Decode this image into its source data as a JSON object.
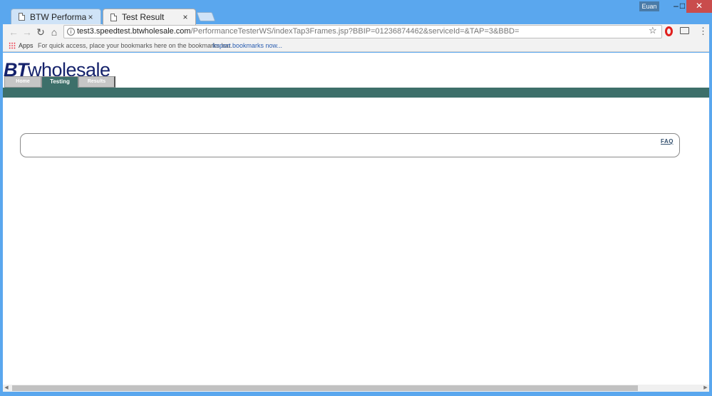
{
  "browser": {
    "tabs": [
      {
        "title": "BTW Performance Test",
        "close": "×"
      },
      {
        "title": "Test Result",
        "close": "×"
      }
    ],
    "profile_name": "Euan",
    "window_buttons": {
      "minimize": "–",
      "maximize": "□",
      "close": "✕"
    },
    "nav": {
      "back": "←",
      "forward": "→",
      "reload": "↻",
      "home": "⌂"
    },
    "url": {
      "host": "test3.speedtest.btwholesale.com",
      "path": "/PerformanceTesterWS/indexTap3Frames.jsp?BBIP=01236874462&serviceId=&TAP=3&BBD="
    },
    "star": "☆",
    "menu": "⋮",
    "bookmarks": {
      "apps_label": "Apps",
      "hint": "For quick access, place your bookmarks here on the bookmarks bar.",
      "import_link": "Import bookmarks now..."
    }
  },
  "page": {
    "logo": {
      "bt": "BT",
      "wholesale": "wholesale"
    },
    "nav_tabs": [
      {
        "label": "Home"
      },
      {
        "label": "Testing"
      },
      {
        "label": "Results"
      }
    ],
    "faq_link": "FAQ"
  },
  "scrollbar": {
    "left_arrow": "◀",
    "right_arrow": "▶"
  },
  "colors": {
    "window_frame": "#5aa7ee",
    "teal_bar": "#3d6f6a",
    "logo_blue": "#15226b",
    "close_button": "#c94c4c"
  }
}
